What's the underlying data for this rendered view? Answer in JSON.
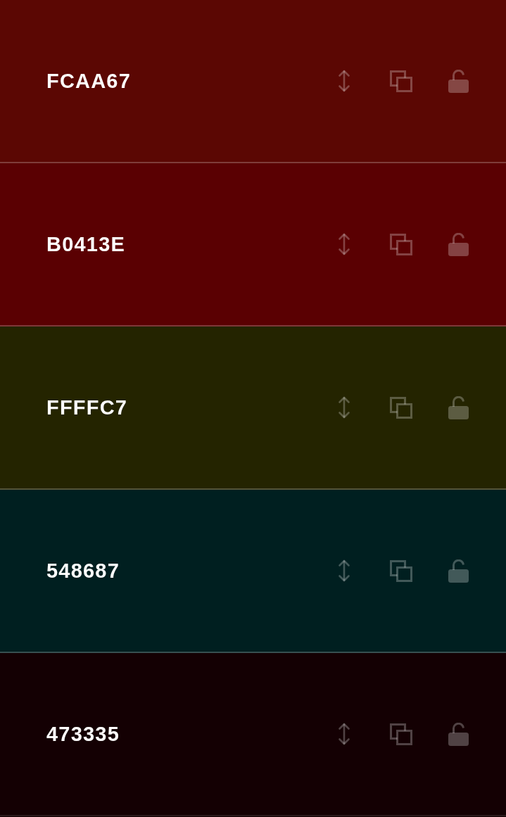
{
  "colors": [
    {
      "hex": "FCAA67",
      "color": "#5b0703",
      "locked": false
    },
    {
      "hex": "B0413E",
      "color": "#5a0002",
      "locked": false
    },
    {
      "hex": "FFFFC7",
      "color": "#242400",
      "locked": false
    },
    {
      "hex": "548687",
      "color": "#001f20",
      "locked": false
    },
    {
      "hex": "473335",
      "color": "#140003",
      "locked": false
    }
  ]
}
